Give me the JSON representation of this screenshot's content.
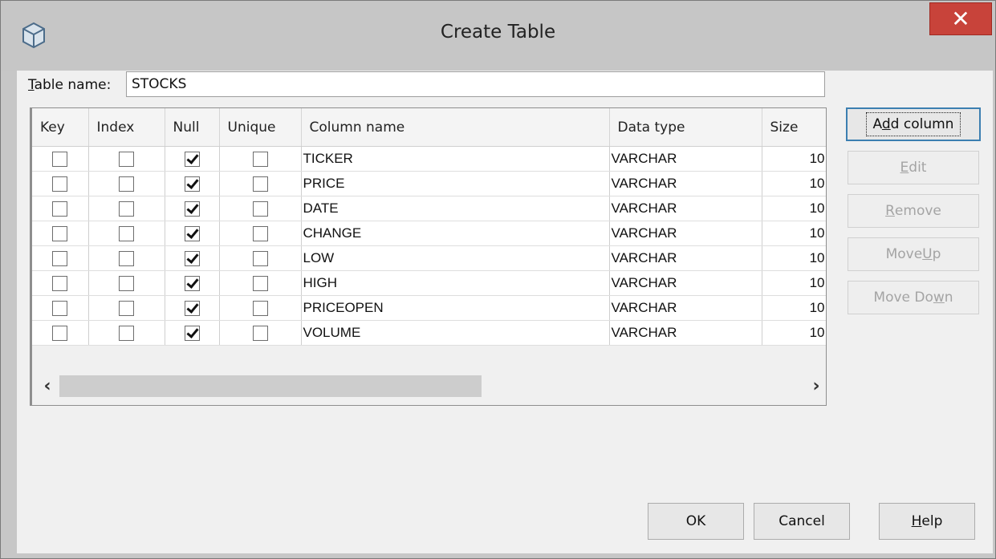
{
  "window": {
    "title": "Create Table",
    "close_glyph": "✕",
    "icon": "cube-icon"
  },
  "table_name": {
    "label": "Table name:",
    "label_mnemonic": "T",
    "value": "STOCKS"
  },
  "columns_grid": {
    "headers": [
      "Key",
      "Index",
      "Null",
      "Unique",
      "Column name",
      "Data type",
      "Size"
    ],
    "rows": [
      {
        "key": false,
        "index": false,
        "null": true,
        "unique": false,
        "name": "TICKER",
        "type": "VARCHAR",
        "size": "10"
      },
      {
        "key": false,
        "index": false,
        "null": true,
        "unique": false,
        "name": "PRICE",
        "type": "VARCHAR",
        "size": "10"
      },
      {
        "key": false,
        "index": false,
        "null": true,
        "unique": false,
        "name": "DATE",
        "type": "VARCHAR",
        "size": "10"
      },
      {
        "key": false,
        "index": false,
        "null": true,
        "unique": false,
        "name": "CHANGE",
        "type": "VARCHAR",
        "size": "10"
      },
      {
        "key": false,
        "index": false,
        "null": true,
        "unique": false,
        "name": "LOW",
        "type": "VARCHAR",
        "size": "10"
      },
      {
        "key": false,
        "index": false,
        "null": true,
        "unique": false,
        "name": "HIGH",
        "type": "VARCHAR",
        "size": "10"
      },
      {
        "key": false,
        "index": false,
        "null": true,
        "unique": false,
        "name": "PRICEOPEN",
        "type": "VARCHAR",
        "size": "10"
      },
      {
        "key": false,
        "index": false,
        "null": true,
        "unique": false,
        "name": "VOLUME",
        "type": "VARCHAR",
        "size": "10"
      }
    ],
    "scroll_left_glyph": "‹",
    "scroll_right_glyph": "›"
  },
  "side_buttons": {
    "add_column": {
      "label": "Add column",
      "mnemonic": "d",
      "enabled": true
    },
    "edit": {
      "label": "Edit",
      "mnemonic": "E",
      "enabled": false
    },
    "remove": {
      "label": "Remove",
      "mnemonic": "R",
      "enabled": false
    },
    "move_up": {
      "label": "Move Up",
      "mnemonic": "U",
      "enabled": false
    },
    "move_down": {
      "label": "Move Down",
      "mnemonic": "w",
      "enabled": false
    }
  },
  "footer_buttons": {
    "ok": "OK",
    "cancel": "Cancel",
    "help": "Help"
  },
  "colors": {
    "close_red": "#c8433a",
    "default_button_border": "#3c7fb1",
    "disabled_text": "#a4a4a4"
  }
}
